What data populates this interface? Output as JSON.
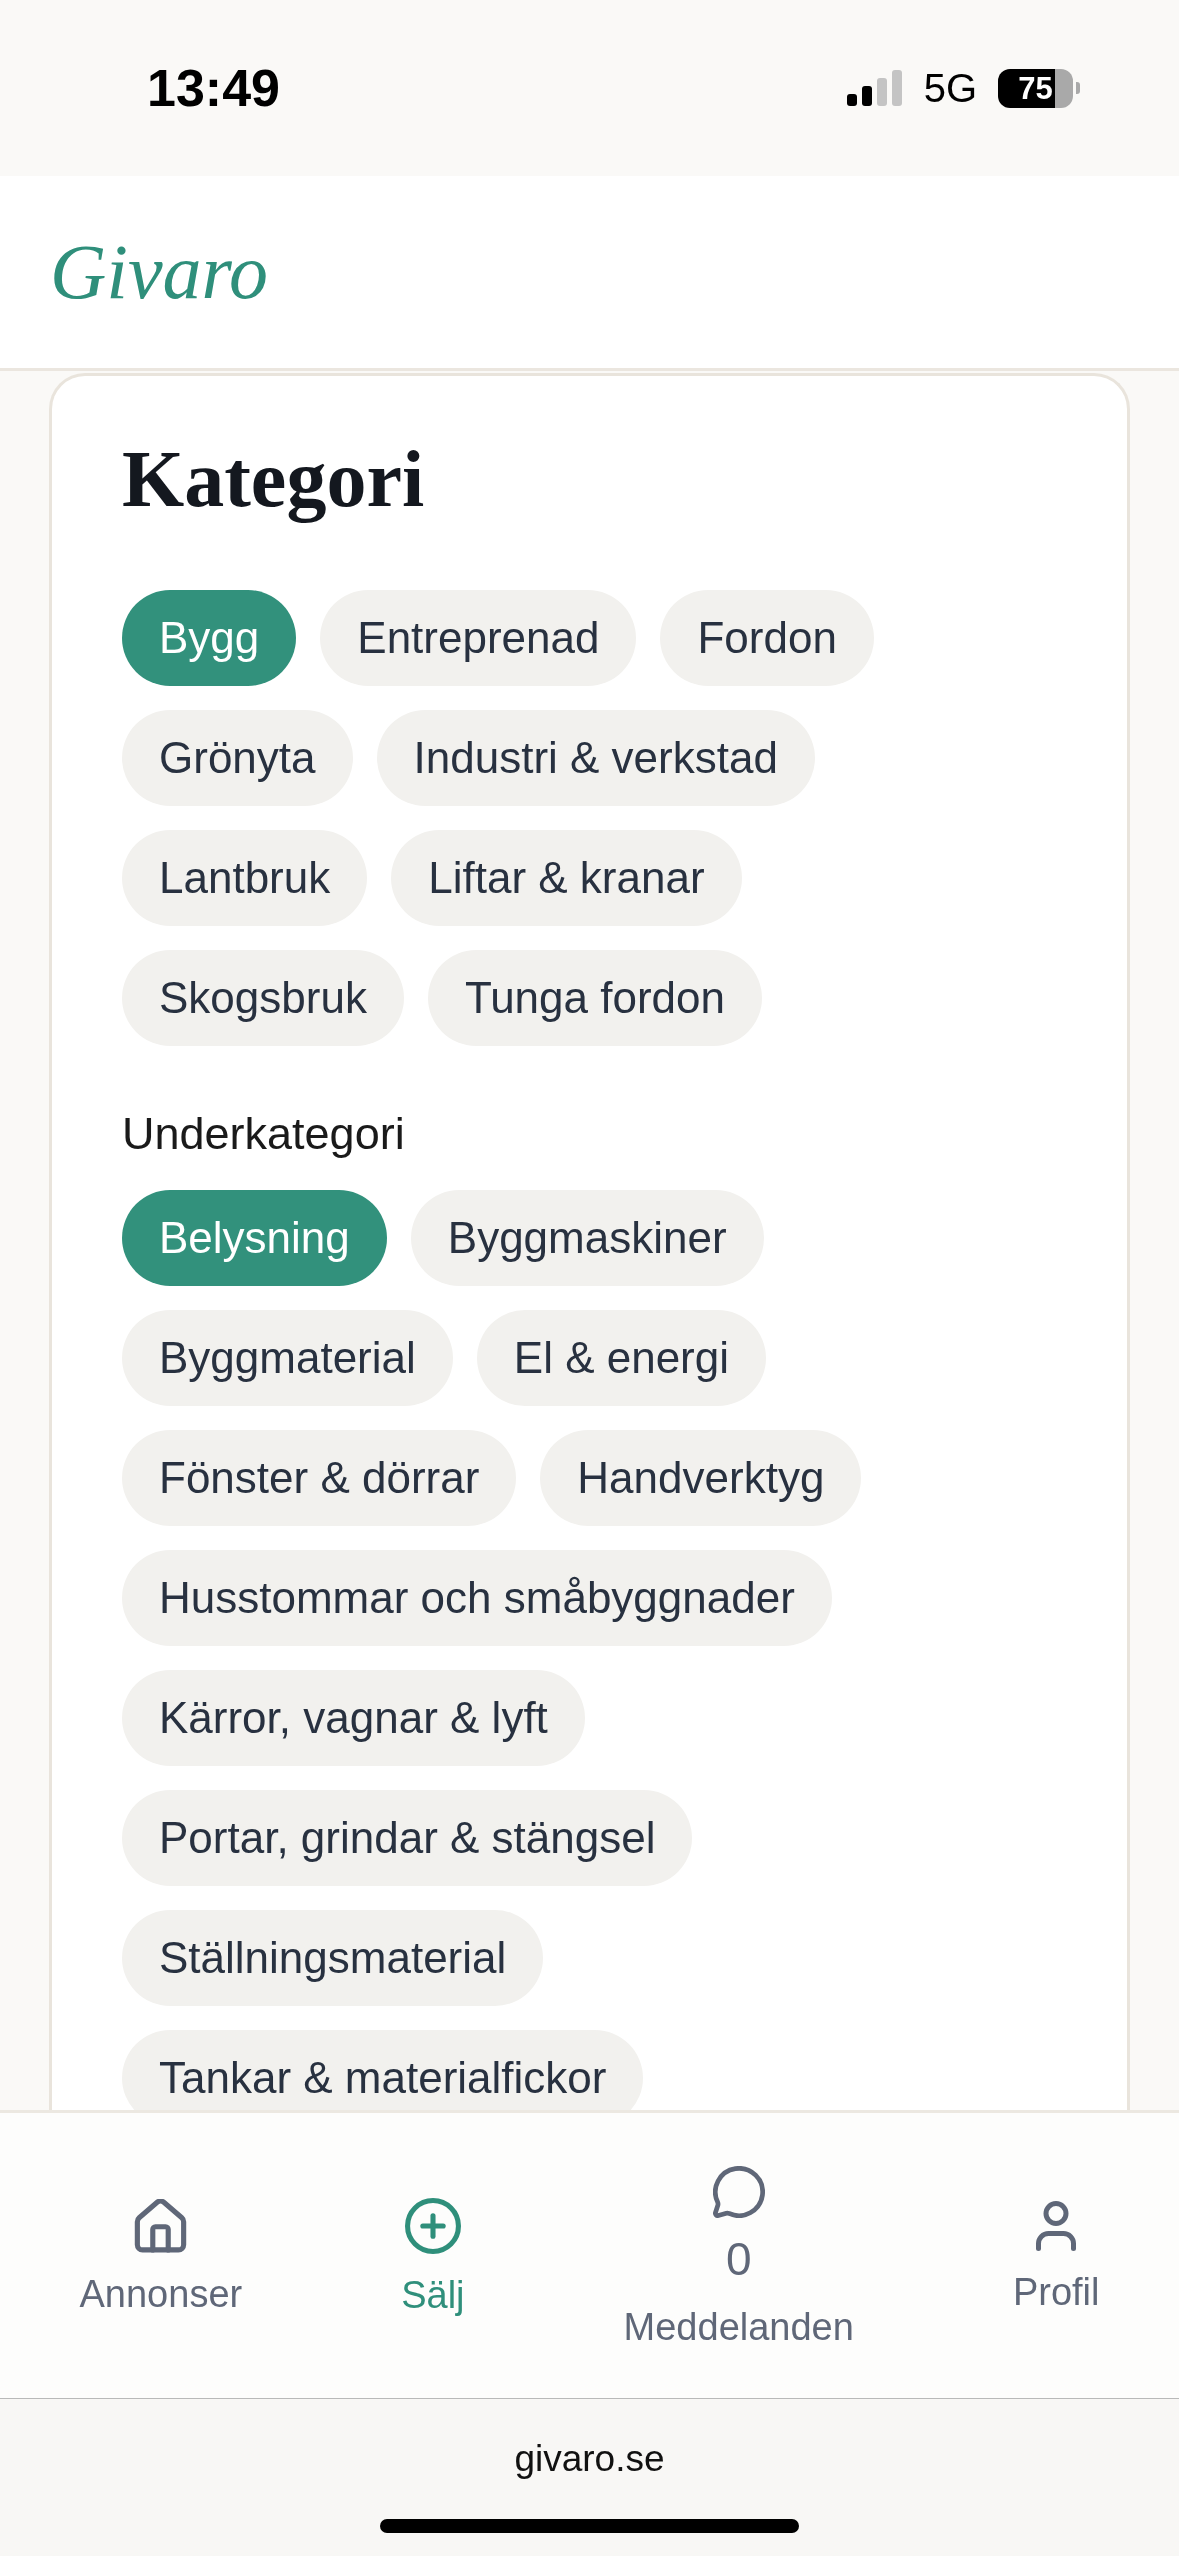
{
  "status_bar": {
    "time": "13:49",
    "network": "5G",
    "battery": "75"
  },
  "header": {
    "logo": "Givaro"
  },
  "category_panel": {
    "title": "Kategori",
    "categories": [
      {
        "label": "Bygg",
        "selected": true
      },
      {
        "label": "Entreprenad",
        "selected": false
      },
      {
        "label": "Fordon",
        "selected": false
      },
      {
        "label": "Grönyta",
        "selected": false
      },
      {
        "label": "Industri & verkstad",
        "selected": false
      },
      {
        "label": "Lantbruk",
        "selected": false
      },
      {
        "label": "Liftar & kranar",
        "selected": false
      },
      {
        "label": "Skogsbruk",
        "selected": false
      },
      {
        "label": "Tunga fordon",
        "selected": false
      }
    ],
    "subcategory_title": "Underkategori",
    "subcategories": [
      {
        "label": "Belysning",
        "selected": true
      },
      {
        "label": "Byggmaskiner",
        "selected": false
      },
      {
        "label": "Byggmaterial",
        "selected": false
      },
      {
        "label": "El & energi",
        "selected": false
      },
      {
        "label": "Fönster & dörrar",
        "selected": false
      },
      {
        "label": "Handverktyg",
        "selected": false
      },
      {
        "label": "Husstommar och småbyggnader",
        "selected": false
      },
      {
        "label": "Kärror, vagnar & lyft",
        "selected": false
      },
      {
        "label": "Portar, grindar & stängsel",
        "selected": false
      },
      {
        "label": "Ställningsmaterial",
        "selected": false
      },
      {
        "label": "Tankar & materialfickor",
        "selected": false
      }
    ]
  },
  "bottom_nav": [
    {
      "kind": "home",
      "label": "Annonser",
      "selected": false
    },
    {
      "kind": "add",
      "label": "Sälj",
      "selected": true
    },
    {
      "kind": "messages",
      "label": "Meddelanden",
      "count": "0",
      "selected": false
    },
    {
      "kind": "profile",
      "label": "Profil",
      "selected": false
    }
  ],
  "browser_bar": {
    "url": "givaro.se"
  }
}
